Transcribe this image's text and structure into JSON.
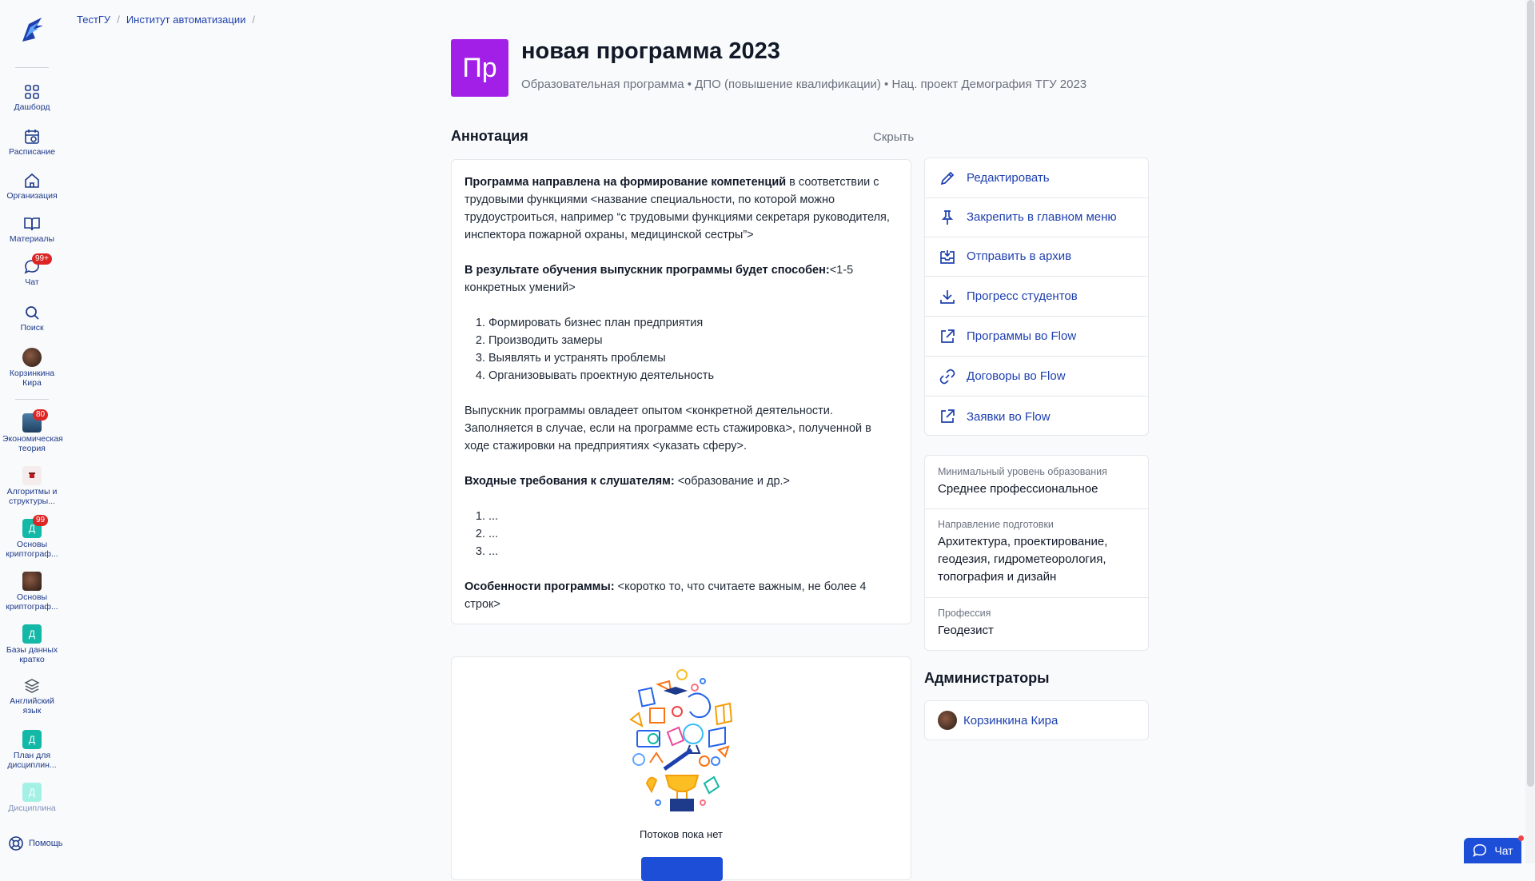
{
  "breadcrumb": [
    "ТестГУ",
    "Институт автоматизации",
    "/"
  ],
  "breadcrumb_sep": "/",
  "sidebar": {
    "nav": [
      {
        "label": "Дашборд",
        "icon": "grid-icon"
      },
      {
        "label": "Расписание",
        "icon": "calendar-icon"
      },
      {
        "label": "Организация",
        "icon": "home-icon"
      },
      {
        "label": "Материалы",
        "icon": "book-icon"
      },
      {
        "label": "Чат",
        "icon": "chat-icon",
        "badge": "99+"
      },
      {
        "label": "Поиск",
        "icon": "search-icon"
      },
      {
        "label": "Корзинкина Кира",
        "icon": "user-avatar"
      }
    ],
    "courses": [
      {
        "label": "Экономическая теория",
        "badge": "80",
        "icon_letter": "",
        "color": "#2f4f6f"
      },
      {
        "label": "Алгоритмы и структуры...",
        "badge": "",
        "icon_letter": "",
        "color": "#f3e8e8"
      },
      {
        "label": "Основы криптограф...",
        "badge": "99",
        "icon_letter": "Д",
        "color": "#14b8a6"
      },
      {
        "label": "Основы криптограф...",
        "badge": "",
        "icon_letter": "",
        "color": "#6b4a3a"
      },
      {
        "label": "Базы данных кратко",
        "badge": "",
        "icon_letter": "Д",
        "color": "#14b8a6"
      },
      {
        "label": "Английский язык",
        "badge": "",
        "icon_letter": "",
        "color": "#ffffff"
      },
      {
        "label": "План для дисциплин...",
        "badge": "",
        "icon_letter": "Д",
        "color": "#14b8a6"
      },
      {
        "label": "Дисциплина",
        "badge": "",
        "icon_letter": "Д",
        "color": "#5eead4"
      }
    ],
    "help_label": "Помощь"
  },
  "program": {
    "icon_text": "Пр",
    "icon_color": "#a21fe8",
    "title": "новая программа 2023",
    "subtitle": "Образовательная программа • ДПО (повышение квалификации) • Нац. проект Демография ТГУ 2023"
  },
  "annotation": {
    "title": "Аннотация",
    "hide_label": "Скрыть",
    "p1_bold": "Программа направлена на формирование компетенций",
    "p1_rest": " в соответствии с трудовыми функциями <название специальности, по которой можно трудоустроиться, например “с трудовыми функциями секретаря руководителя, инспектора пожарной охраны, медицинской сестры”>",
    "p2_bold": "В результате обучения выпускник программы будет способен:",
    "p2_rest": "<1-5 конкретных умений>",
    "skills": [
      "Формировать бизнес план предприятия",
      "Производить замеры",
      "Выявлять и устранять проблемы",
      "Организовывать проектную деятельность"
    ],
    "p3": "Выпускник программы овладеет опытом <конкретной деятельности. Заполняется в случае, если на программе есть стажировка>, полученной в ходе стажировки на предприятиях <указать сферу>.",
    "p4_bold": "Входные требования к слушателям:",
    "p4_rest": " <образование и др.>",
    "reqs": [
      "...",
      "...",
      "..."
    ],
    "p5_bold": "Особенности программы:",
    "p5_rest": " <коротко то, что считаете важным, не более 4 строк>"
  },
  "flows": {
    "empty_text": "Потоков пока нет"
  },
  "actions": [
    {
      "label": "Редактировать",
      "icon": "pencil-icon"
    },
    {
      "label": "Закрепить в главном меню",
      "icon": "pin-icon"
    },
    {
      "label": "Отправить в архив",
      "icon": "archive-icon"
    },
    {
      "label": "Прогресс студентов",
      "icon": "download-icon"
    },
    {
      "label": "Программы во Flow",
      "icon": "external-link-icon"
    },
    {
      "label": "Договоры во Flow",
      "icon": "link-icon"
    },
    {
      "label": "Заявки во Flow",
      "icon": "external-link-icon"
    }
  ],
  "info": [
    {
      "label": "Минимальный уровень образования",
      "value": "Среднее профессиональное"
    },
    {
      "label": "Направление подготовки",
      "value": "Архитектура, проектирование, геодезия, гидрометеорология, топография и дизайн"
    },
    {
      "label": "Профессия",
      "value": "Геодезист"
    }
  ],
  "admins": {
    "title": "Администраторы",
    "list": [
      "Корзинкина Кира"
    ]
  },
  "chat_button": {
    "label": "Чат"
  },
  "colors": {
    "accent": "#1e40af",
    "badge": "#dc2626",
    "program_icon": "#a21fe8"
  }
}
